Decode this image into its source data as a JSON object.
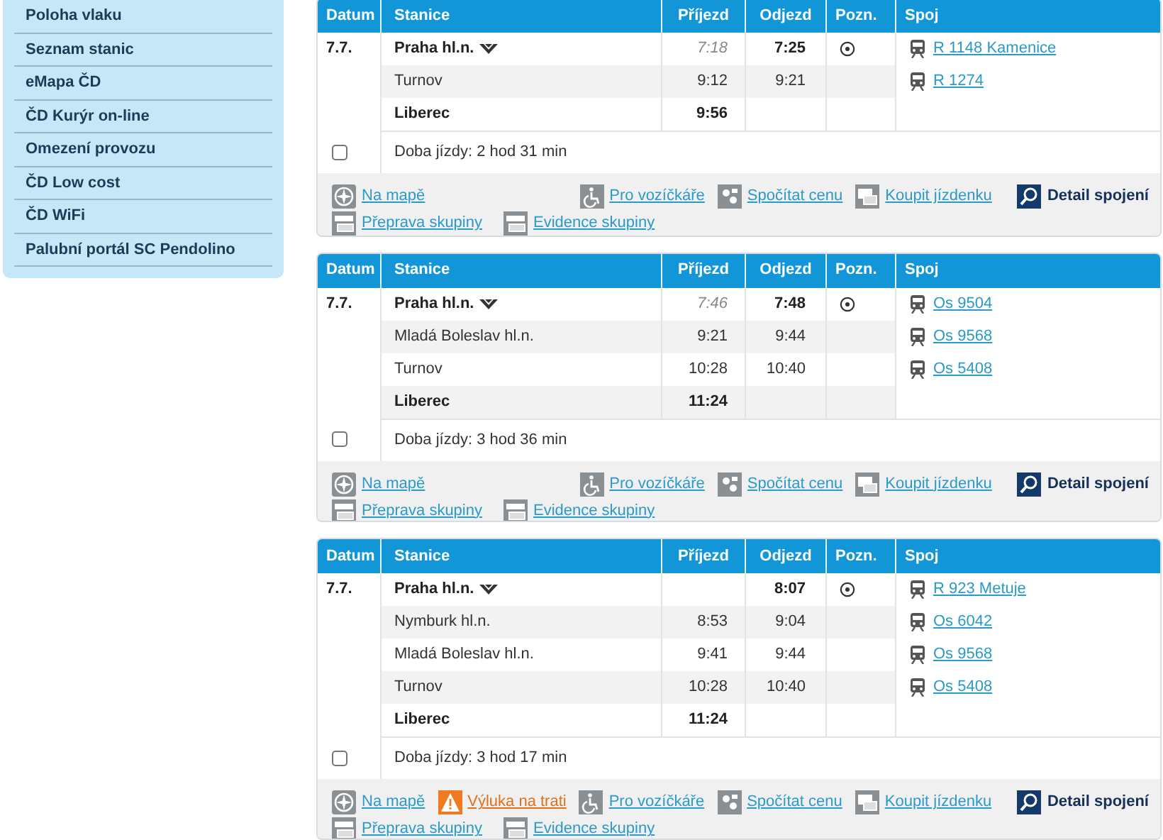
{
  "sidebar": {
    "items": [
      "Poloha vlaku",
      "Seznam stanic",
      "eMapa ČD",
      "ČD Kurýr on-line",
      "Omezení provozu",
      "ČD Low cost",
      "ČD WiFi",
      "Palubní portál SC Pendolino"
    ]
  },
  "connections": [
    {
      "columns": [
        "Datum",
        "Stanice",
        "Příjezd",
        "Odjezd",
        "Pozn.",
        "Spoj"
      ],
      "date": "7.7.",
      "stops": [
        {
          "kind": "origin",
          "station": "Praha hl.n.",
          "arrival": "7:18",
          "departure": "7:25"
        },
        {
          "kind": "via",
          "station": "Turnov",
          "arrival": "9:12",
          "departure": "9:21"
        },
        {
          "kind": "destination",
          "station": "Liberec",
          "arrival": "9:56"
        }
      ],
      "trains": [
        "R 1148 Kamenice",
        "R 1274"
      ],
      "checked": false,
      "duration": "Doba jízdy: 2 hod 31 min",
      "actions": [
        {
          "kind": "map",
          "label": "Na mapě"
        },
        {
          "kind": "wheelchair",
          "label": "Pro vozíčkáře"
        },
        {
          "kind": "price",
          "label": "Spočítat cenu"
        },
        {
          "kind": "ticket",
          "label": "Koupit jízdenku"
        },
        {
          "kind": "detail",
          "label": "Detail spojení"
        }
      ],
      "actions_2": [
        {
          "kind": "group",
          "label": "Přeprava skupiny"
        },
        {
          "kind": "group",
          "label": "Evidence skupiny"
        }
      ]
    },
    {
      "columns": [
        "Datum",
        "Stanice",
        "Příjezd",
        "Odjezd",
        "Pozn.",
        "Spoj"
      ],
      "date": "7.7.",
      "stops": [
        {
          "kind": "origin",
          "station": "Praha hl.n.",
          "arrival": "7:46",
          "departure": "7:48"
        },
        {
          "kind": "via",
          "station": "Mladá Boleslav hl.n.",
          "arrival": "9:21",
          "departure": "9:44"
        },
        {
          "kind": "via",
          "station": "Turnov",
          "arrival": "10:28",
          "departure": "10:40"
        },
        {
          "kind": "destination",
          "station": "Liberec",
          "arrival": "11:24"
        }
      ],
      "trains": [
        "Os 9504",
        "Os 9568",
        "Os 5408"
      ],
      "checked": false,
      "duration": "Doba jízdy: 3 hod 36 min",
      "actions": [
        {
          "kind": "map",
          "label": "Na mapě"
        },
        {
          "kind": "wheelchair",
          "label": "Pro vozíčkáře"
        },
        {
          "kind": "price",
          "label": "Spočítat cenu"
        },
        {
          "kind": "ticket",
          "label": "Koupit jízdenku"
        },
        {
          "kind": "detail",
          "label": "Detail spojení"
        }
      ],
      "actions_2": [
        {
          "kind": "group",
          "label": "Přeprava skupiny"
        },
        {
          "kind": "group",
          "label": "Evidence skupiny"
        }
      ]
    },
    {
      "columns": [
        "Datum",
        "Stanice",
        "Příjezd",
        "Odjezd",
        "Pozn.",
        "Spoj"
      ],
      "date": "7.7.",
      "stops": [
        {
          "kind": "origin",
          "station": "Praha hl.n.",
          "departure": "8:07"
        },
        {
          "kind": "via",
          "station": "Nymburk hl.n.",
          "arrival": "8:53",
          "departure": "9:04"
        },
        {
          "kind": "via",
          "station": "Mladá Boleslav hl.n.",
          "arrival": "9:41",
          "departure": "9:44"
        },
        {
          "kind": "via",
          "station": "Turnov",
          "arrival": "10:28",
          "departure": "10:40"
        },
        {
          "kind": "destination",
          "station": "Liberec",
          "arrival": "11:24"
        }
      ],
      "trains": [
        "R 923 Metuje",
        "Os 6042",
        "Os 9568",
        "Os 5408"
      ],
      "checked": false,
      "duration": "Doba jízdy: 3 hod 17 min",
      "actions": [
        {
          "kind": "map",
          "label": "Na mapě"
        },
        {
          "kind": "closure",
          "label": "Výluka na trati"
        },
        {
          "kind": "wheelchair",
          "label": "Pro vozíčkáře"
        },
        {
          "kind": "price",
          "label": "Spočítat cenu"
        },
        {
          "kind": "ticket",
          "label": "Koupit jízdenku"
        },
        {
          "kind": "detail",
          "label": "Detail spojení"
        }
      ],
      "actions_2": [
        {
          "kind": "group",
          "label": "Přeprava skupiny"
        },
        {
          "kind": "group",
          "label": "Evidence skupiny"
        }
      ]
    }
  ]
}
